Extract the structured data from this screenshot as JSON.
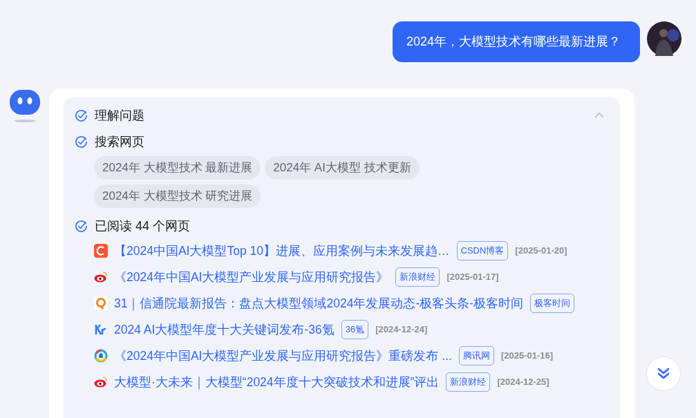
{
  "user_message": {
    "text": "2024年，大模型技术有哪些最新进展？"
  },
  "answer": {
    "expanded": true,
    "steps": [
      {
        "title": "理解问题",
        "done": true
      },
      {
        "title": "搜索网页",
        "done": true,
        "queries": [
          "2024年 大模型技术 最新进展",
          "2024年 AI大模型 技术更新",
          "2024年 大模型技术 研究进展"
        ]
      },
      {
        "title": "已阅读 44 个网页",
        "done": true,
        "sources": [
          {
            "kind": "csdn",
            "title": "【2024中国AI大模型Top 10】进展、应用案例与未来发展趋…",
            "site": "CSDN博客",
            "date": "[2025-01-20]"
          },
          {
            "kind": "weibo",
            "title": "《2024年中国AI大模型产业发展与应用研究报告》",
            "site": "新浪财经",
            "date": "[2025-01-17]"
          },
          {
            "kind": "geek",
            "title": "31｜信通院最新报告：盘点大模型领域2024年发展动态-极客头条-极客时间",
            "site": "极客时间"
          },
          {
            "kind": "kr",
            "title": "2024 AI大模型年度十大关键词发布-36氪",
            "site": "36氪",
            "date": "[2024-12-24]"
          },
          {
            "kind": "tencent",
            "title": "《2024年中国AI大模型产业发展与应用研究报告》重磅发布 ...",
            "site": "腾讯网",
            "date": "[2025-01-16]"
          },
          {
            "kind": "weibo",
            "title": "大模型·大未来｜大模型“2024年度十大突破技术和进展”评出",
            "site": "新浪财经",
            "date": "[2024-12-25]"
          }
        ]
      }
    ]
  }
}
